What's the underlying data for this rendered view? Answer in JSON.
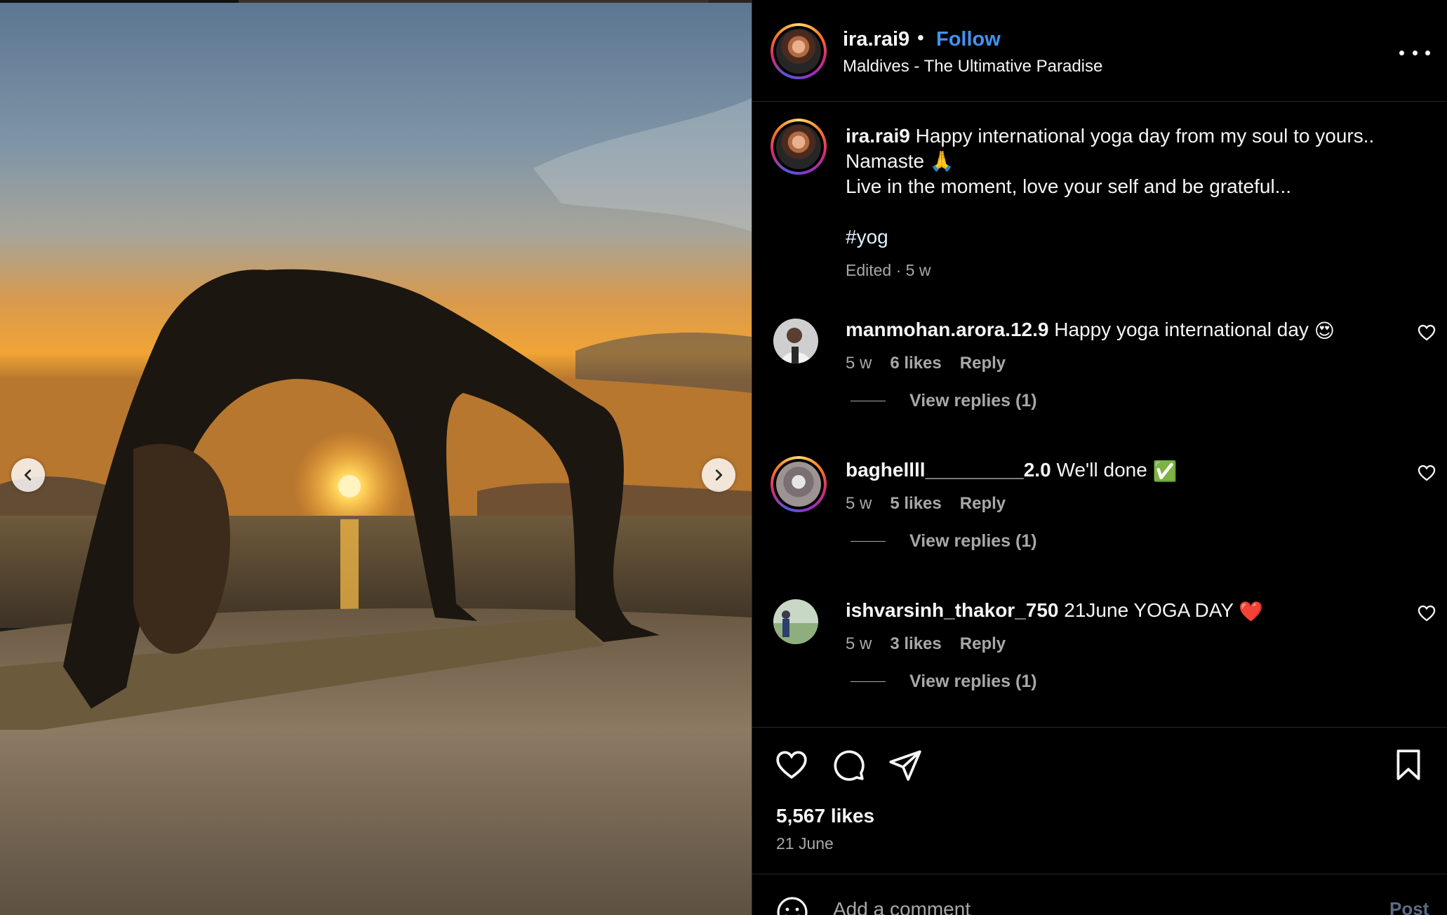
{
  "colors": {
    "background": "#000000",
    "text": "#f5f5f5",
    "muted": "#a8a8a8",
    "link": "#4193ef",
    "post_disabled": "#5b6b85",
    "divider": "#262626"
  },
  "media": {
    "prev_icon": "chevron-left-icon",
    "next_icon": "chevron-right-icon"
  },
  "header": {
    "username": "ira.rai9",
    "separator": "•",
    "follow_label": "Follow",
    "location": "Maldives - The Ultimative Paradise",
    "more_icon": "more-horizontal-icon"
  },
  "caption": {
    "username": "ira.rai9",
    "line1": "Happy international yoga day from my soul to yours..",
    "line2": "Namaste 🙏",
    "line3": "Live in the moment, love your self and be grateful...",
    "hashtag": "#yog",
    "meta": "Edited · 5 w"
  },
  "comments": [
    {
      "username": "manmohan.arora.12.9",
      "text": "Happy yoga international day",
      "emoji": "😍",
      "time": "5 w",
      "likes": "6 likes",
      "reply_label": "Reply",
      "view_replies": "View replies (1)"
    },
    {
      "username": "baghellll_________2.0",
      "text": "We'll done",
      "emoji": "✅",
      "time": "5 w",
      "likes": "5 likes",
      "reply_label": "Reply",
      "view_replies": "View replies (1)"
    },
    {
      "username": "ishvarsinh_thakor_750",
      "text": "21June YOGA DAY",
      "emoji": "❤️",
      "time": "5 w",
      "likes": "3 likes",
      "reply_label": "Reply",
      "view_replies": "View replies (1)"
    }
  ],
  "actions": {
    "like_icon": "heart-icon",
    "comment_icon": "comment-icon",
    "share_icon": "send-icon",
    "save_icon": "bookmark-icon",
    "likes_count": "5,567 likes",
    "date": "21 June"
  },
  "add_comment": {
    "emoji_icon": "smiley-icon",
    "placeholder": "Add a comment",
    "post_label": "Post"
  }
}
